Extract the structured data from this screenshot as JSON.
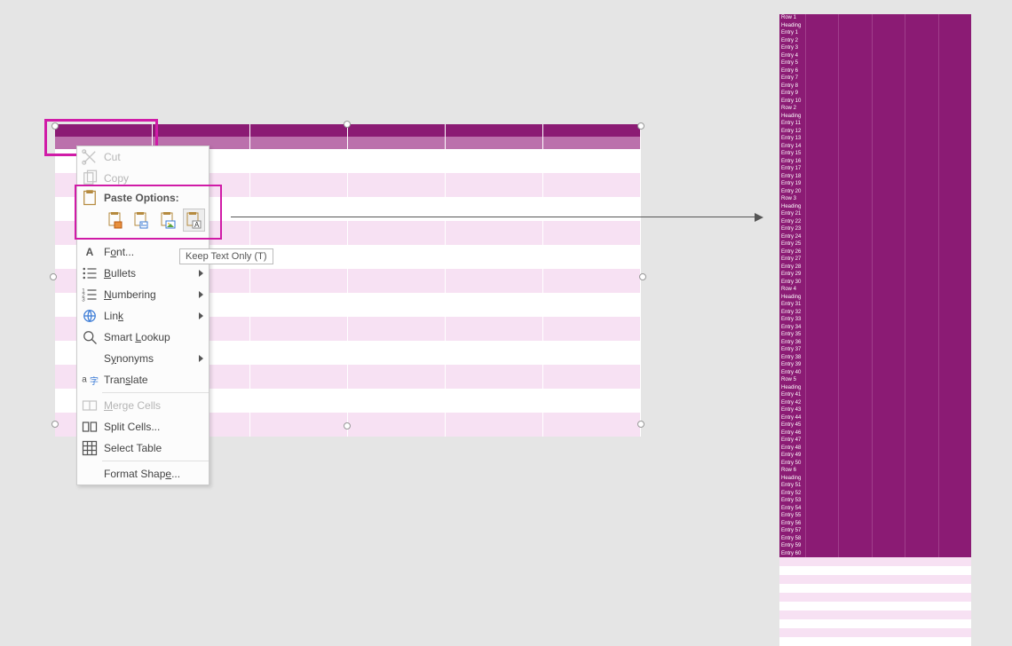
{
  "colors": {
    "header_dark": "#8b1b74",
    "header_light": "#bb71ac",
    "stripe": "#f7e1f3",
    "highlight": "#d01ba7"
  },
  "context_menu": {
    "cut": "Cut",
    "copy": "Copy",
    "paste_options": "Paste Options:",
    "font": "Font...",
    "bullets": "Bullets",
    "numbering": "Numbering",
    "link": "Link",
    "smart_lookup": "Smart Lookup",
    "synonyms": "Synonyms",
    "translate": "Translate",
    "merge_cells": "Merge Cells",
    "split_cells": "Split Cells...",
    "select_table": "Select Table",
    "format_shape": "Format Shape...",
    "paste_icons": [
      "use-destination-theme",
      "keep-source-formatting",
      "picture",
      "keep-text-only"
    ]
  },
  "tooltip": "Keep Text Only (T)",
  "right_table": {
    "groups": [
      {
        "title": "Row 1",
        "heading": "Heading",
        "entries": [
          "Entry 1",
          "Entry 2",
          "Entry 3",
          "Entry 4",
          "Entry 5",
          "Entry 6",
          "Entry 7",
          "Entry 8",
          "Entry 9",
          "Entry 10"
        ]
      },
      {
        "title": "Row 2",
        "heading": "Heading",
        "entries": [
          "Entry 11",
          "Entry 12",
          "Entry 13",
          "Entry 14",
          "Entry 15",
          "Entry 16",
          "Entry 17",
          "Entry 18",
          "Entry 19",
          "Entry 20"
        ]
      },
      {
        "title": "Row 3",
        "heading": "Heading",
        "entries": [
          "Entry 21",
          "Entry 22",
          "Entry 23",
          "Entry 24",
          "Entry 25",
          "Entry 26",
          "Entry 27",
          "Entry 28",
          "Entry 29",
          "Entry 30"
        ]
      },
      {
        "title": "Row 4",
        "heading": "Heading",
        "entries": [
          "Entry 31",
          "Entry 32",
          "Entry 33",
          "Entry 34",
          "Entry 35",
          "Entry 36",
          "Entry 37",
          "Entry 38",
          "Entry 39",
          "Entry 40"
        ]
      },
      {
        "title": "Row 5",
        "heading": "Heading",
        "entries": [
          "Entry 41",
          "Entry 42",
          "Entry 43",
          "Entry 44",
          "Entry 45",
          "Entry 46",
          "Entry 47",
          "Entry 48",
          "Entry 49",
          "Entry 50"
        ]
      },
      {
        "title": "Row 6",
        "heading": "Heading",
        "entries": [
          "Entry 51",
          "Entry 52",
          "Entry 53",
          "Entry 54",
          "Entry 55",
          "Entry 56",
          "Entry 57",
          "Entry 58",
          "Entry 59",
          "Entry 60"
        ]
      }
    ],
    "columns": 6
  },
  "left_table": {
    "columns": 6,
    "body_rows": 12
  }
}
